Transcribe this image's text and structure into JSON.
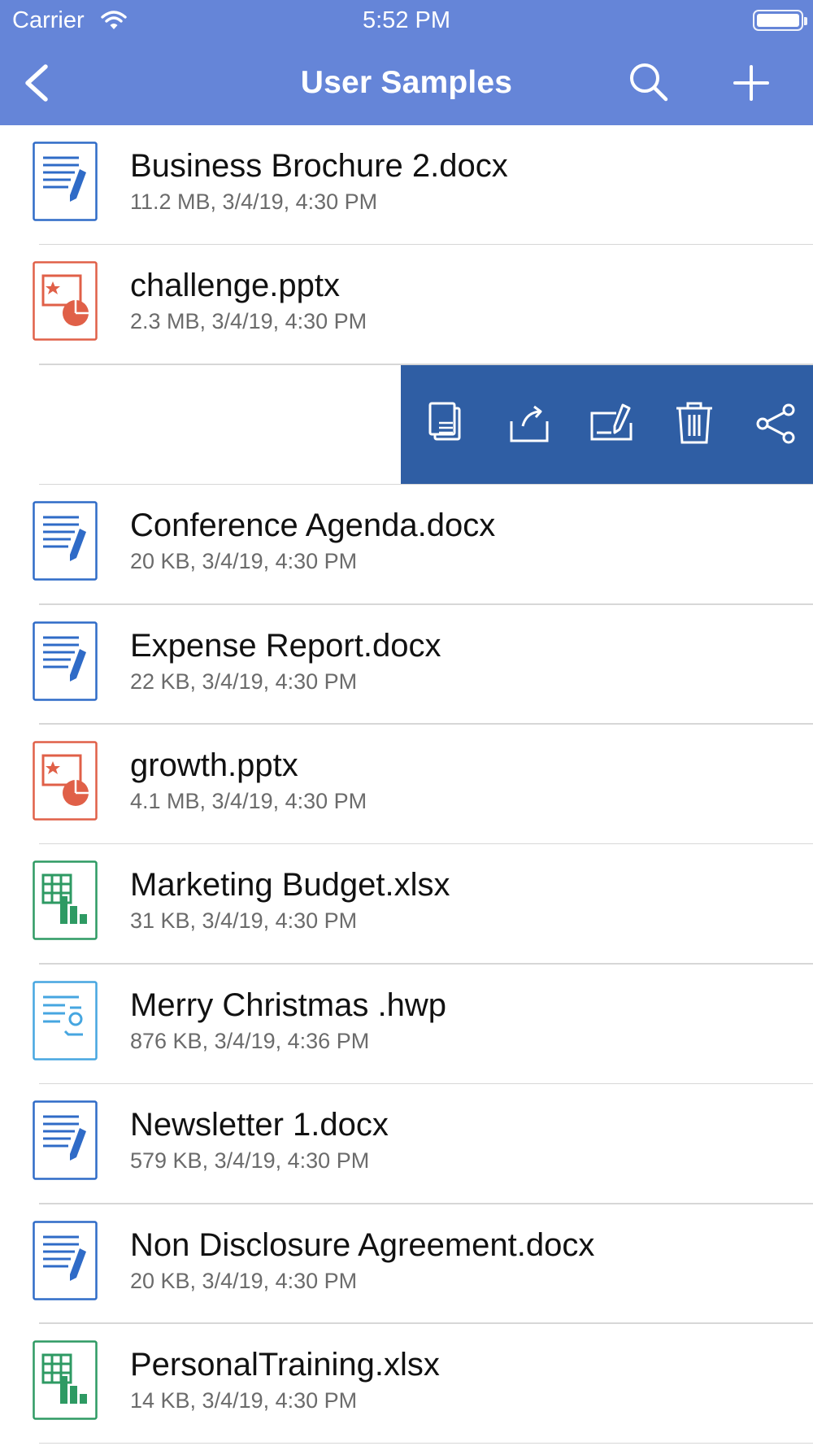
{
  "status_bar": {
    "carrier": "Carrier",
    "time": "5:52 PM"
  },
  "nav": {
    "title": "User Samples",
    "back_icon": "chevron-left-icon",
    "search_icon": "search-icon",
    "add_icon": "plus-icon"
  },
  "colors": {
    "header": "#6585d8",
    "action_bar": "#2f5ea4",
    "docx": "#2f6bc7",
    "pptx": "#e06048",
    "xlsx": "#2e9a63",
    "hwp": "#46a6e0"
  },
  "swipe_actions": [
    "copy-icon",
    "export-icon",
    "rename-icon",
    "trash-icon",
    "share-icon"
  ],
  "files": [
    {
      "name": "Business Brochure 2.docx",
      "meta": "11.2 MB, 3/4/19, 4:30 PM",
      "type": "docx"
    },
    {
      "name": "challenge.pptx",
      "meta": "2.3 MB, 3/4/19, 4:30 PM",
      "type": "pptx"
    },
    {
      "name": "Conference Agenda.docx",
      "meta": "20 KB, 3/4/19, 4:30 PM",
      "type": "docx"
    },
    {
      "name": "Expense Report.docx",
      "meta": "22 KB, 3/4/19, 4:30 PM",
      "type": "docx"
    },
    {
      "name": "growth.pptx",
      "meta": "4.1 MB, 3/4/19, 4:30 PM",
      "type": "pptx"
    },
    {
      "name": "Marketing Budget.xlsx",
      "meta": "31 KB, 3/4/19, 4:30 PM",
      "type": "xlsx"
    },
    {
      "name": "Merry Christmas .hwp",
      "meta": "876 KB, 3/4/19, 4:36 PM",
      "type": "hwp"
    },
    {
      "name": "Newsletter 1.docx",
      "meta": "579 KB, 3/4/19, 4:30 PM",
      "type": "docx"
    },
    {
      "name": "Non Disclosure Agreement.docx",
      "meta": "20 KB, 3/4/19, 4:30 PM",
      "type": "docx"
    },
    {
      "name": "PersonalTraining.xlsx",
      "meta": "14 KB, 3/4/19, 4:30 PM",
      "type": "xlsx"
    }
  ]
}
